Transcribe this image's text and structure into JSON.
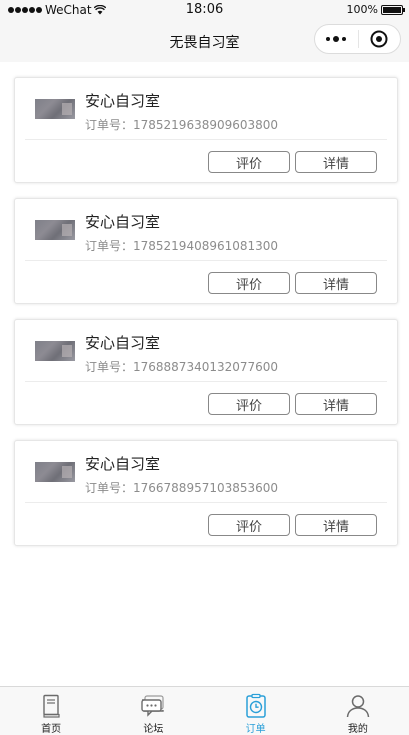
{
  "status_bar": {
    "carrier": "WeChat",
    "time": "18:06",
    "battery": "100%",
    "battery_level": 1.0
  },
  "nav": {
    "title": "无畏自习室"
  },
  "orders": [
    {
      "name": "安心自习室",
      "number": "订单号：1785219638909603800",
      "review_label": "评价",
      "detail_label": "详情"
    },
    {
      "name": "安心自习室",
      "number": "订单号：1785219408961081300",
      "review_label": "评价",
      "detail_label": "详情"
    },
    {
      "name": "安心自习室",
      "number": "订单号：1768887340132077600",
      "review_label": "评价",
      "detail_label": "详情"
    },
    {
      "name": "安心自习室",
      "number": "订单号：1766788957103853600",
      "review_label": "评价",
      "detail_label": "详情"
    }
  ],
  "tabs": [
    {
      "label": "首页",
      "icon": "book-icon",
      "active": false
    },
    {
      "label": "论坛",
      "icon": "chat-bubble-icon",
      "active": false
    },
    {
      "label": "订单",
      "icon": "order-timer-icon",
      "active": true
    },
    {
      "label": "我的",
      "icon": "user-icon",
      "active": false
    }
  ],
  "colors": {
    "accent": "#2a9fd8",
    "background": "#ffffff",
    "bar_background": "#f6f6f6"
  }
}
